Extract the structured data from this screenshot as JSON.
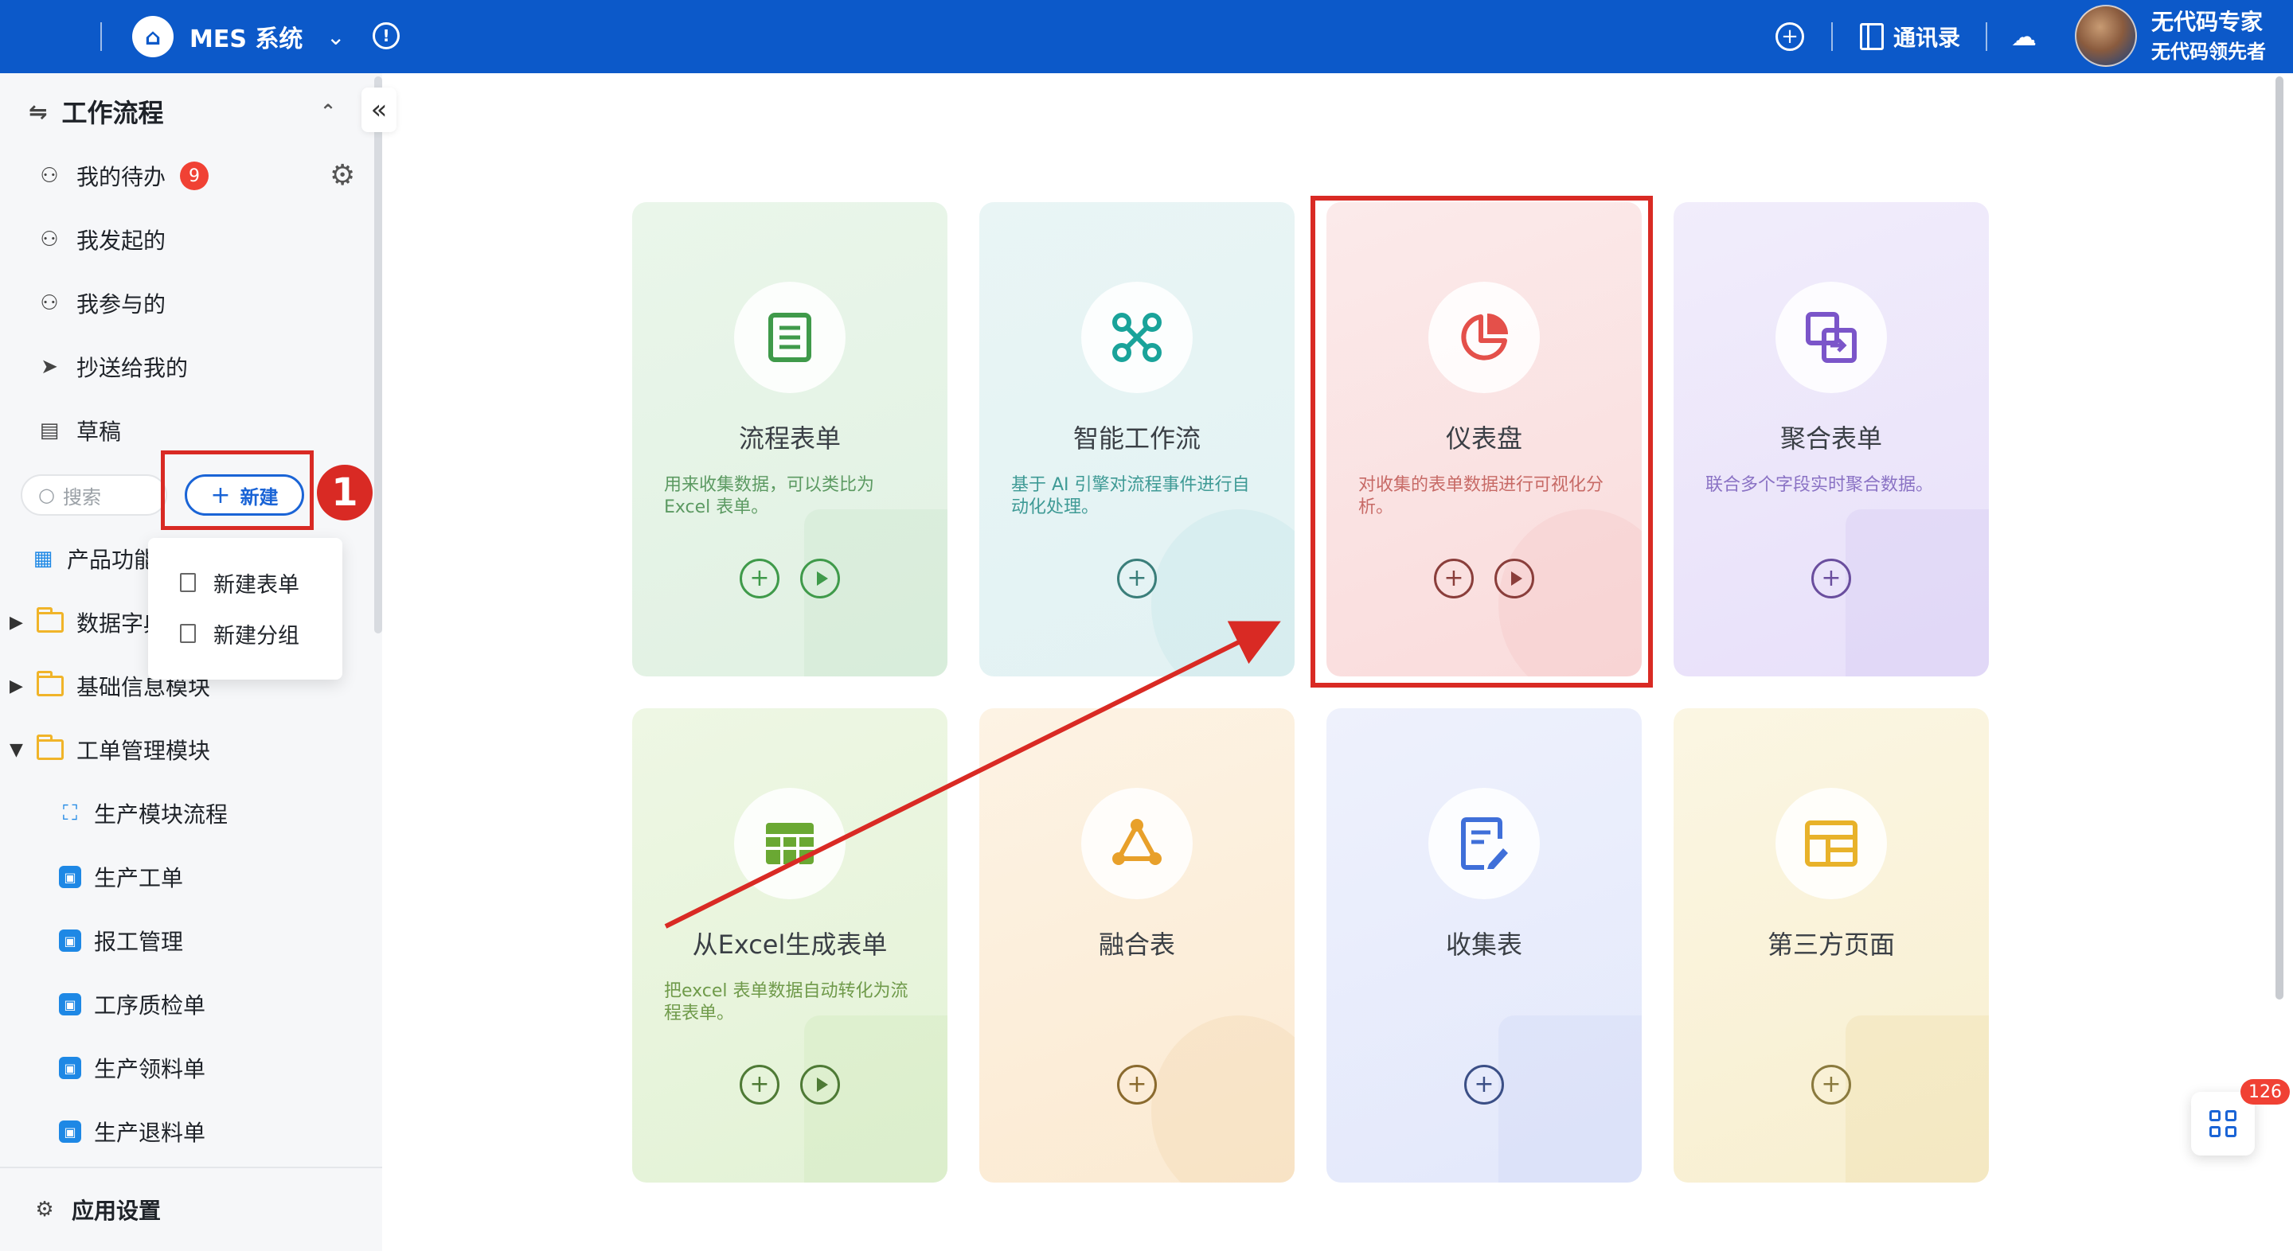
{
  "topbar": {
    "app_title": "MES 系统",
    "contacts_label": "通讯录",
    "user_name": "无代码专家",
    "user_subtitle": "无代码领先者",
    "icons": [
      "apps-grid-icon",
      "home-icon",
      "chevron-down-icon",
      "info-icon",
      "plus-icon",
      "contacts-icon",
      "cloud-icon"
    ]
  },
  "sidebar": {
    "section_title": "工作流程",
    "items": [
      {
        "label": "我的待办",
        "icon": "todo-icon",
        "badge": "9"
      },
      {
        "label": "我发起的",
        "icon": "user-check-icon"
      },
      {
        "label": "我参与的",
        "icon": "user-plus-icon"
      },
      {
        "label": "抄送给我的",
        "icon": "send-icon"
      },
      {
        "label": "草稿",
        "icon": "draft-icon"
      }
    ],
    "search_placeholder": "搜索",
    "new_button": "新建",
    "step_marker": "1",
    "dropdown": [
      "新建表单",
      "新建分组"
    ],
    "tree": [
      {
        "label": "产品功能",
        "icon": "apps-icon"
      },
      {
        "label": "数据字典",
        "icon": "folder-icon",
        "state": "collapsed"
      },
      {
        "label": "基础信息模块",
        "icon": "folder-icon",
        "state": "collapsed"
      },
      {
        "label": "工单管理模块",
        "icon": "folder-icon",
        "state": "expanded"
      },
      {
        "label": "生产模块流程",
        "icon": "org-chart-icon"
      },
      {
        "label": "生产工单",
        "icon": "module-icon"
      },
      {
        "label": "报工管理",
        "icon": "module-icon"
      },
      {
        "label": "工序质检单",
        "icon": "module-icon"
      },
      {
        "label": "生产领料单",
        "icon": "module-icon"
      },
      {
        "label": "生产退料单",
        "icon": "module-icon"
      }
    ],
    "settings_label": "应用设置"
  },
  "cards": [
    {
      "title": "流程表单",
      "desc": "用来收集数据，可以类比为Excel 表单。",
      "icon": "form-icon",
      "color": "#3f9a4a",
      "has_play": true
    },
    {
      "title": "智能工作流",
      "desc": "基于 AI 引擎对流程事件进行自动化处理。",
      "icon": "workflow-icon",
      "color": "#1aa39a",
      "has_play": false
    },
    {
      "title": "仪表盘",
      "desc": "对收集的表单数据进行可视化分析。",
      "icon": "pie-chart-icon",
      "color": "#e4504a",
      "has_play": true
    },
    {
      "title": "聚合表单",
      "desc": "联合多个字段实时聚合数据。",
      "icon": "aggregate-icon",
      "color": "#7b55c9",
      "has_play": false
    },
    {
      "title": "从Excel生成表单",
      "desc": "把excel 表单数据自动转化为流程表单。",
      "icon": "table-icon",
      "color": "#6aa833",
      "has_play": true
    },
    {
      "title": "融合表",
      "desc": "",
      "icon": "merge-icon",
      "color": "#e8a02a",
      "has_play": false
    },
    {
      "title": "收集表",
      "desc": "",
      "icon": "collect-icon",
      "color": "#3f6fd9",
      "has_play": false
    },
    {
      "title": "第三方页面",
      "desc": "",
      "icon": "page-icon",
      "color": "#e8b22a",
      "has_play": false
    }
  ],
  "float_badge": "126"
}
